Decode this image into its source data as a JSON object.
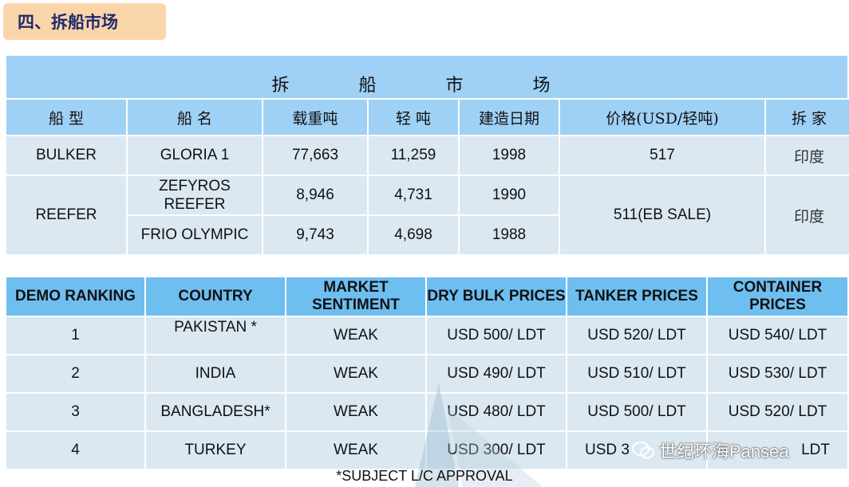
{
  "section_title": "四、拆船市场",
  "table1": {
    "title": "拆 船 市 场",
    "headers": [
      "船  型",
      "船  名",
      "载重吨",
      "轻  吨",
      "建造日期",
      "价格(USD/轻吨)",
      "拆  家"
    ],
    "rows": [
      {
        "type": "BULKER",
        "name": "GLORIA 1",
        "dwt": "77,663",
        "ldt": "11,259",
        "built": "1998",
        "price": "517",
        "buyer": "印度"
      },
      {
        "type": "REEFER",
        "name": "ZEFYROS REEFER",
        "dwt": "8,946",
        "ldt": "4,731",
        "built": "1990",
        "price": "511(EB SALE)",
        "buyer": "印度"
      },
      {
        "name": "FRIO OLYMPIC",
        "dwt": "9,743",
        "ldt": "4,698",
        "built": "1988"
      }
    ]
  },
  "table2": {
    "headers": [
      "DEMO RANKING",
      "COUNTRY",
      "MARKET SENTIMENT",
      "DRY BULK PRICES",
      "TANKER PRICES",
      "CONTAINER PRICES"
    ],
    "rows": [
      {
        "rank": "1",
        "country": "PAKISTAN *",
        "sentiment": "WEAK",
        "dry": "USD 500/ LDT",
        "tanker": "USD 520/ LDT",
        "container": "USD 540/ LDT"
      },
      {
        "rank": "2",
        "country": "INDIA",
        "sentiment": "WEAK",
        "dry": "USD 490/ LDT",
        "tanker": "USD 510/ LDT",
        "container": "USD 530/ LDT"
      },
      {
        "rank": "3",
        "country": "BANGLADESH*",
        "sentiment": "WEAK",
        "dry": "USD 480/ LDT",
        "tanker": "USD 500/ LDT",
        "container": "USD 520/ LDT"
      },
      {
        "rank": "4",
        "country": "TURKEY",
        "sentiment": "WEAK",
        "dry": "USD 300/ LDT",
        "tanker": "USD 3",
        "container": "LDT"
      }
    ]
  },
  "footnote": "*SUBJECT L/C APPROVAL",
  "watermark": "世纪环海Pansea",
  "icons": {
    "wechat": "wechat-icon"
  }
}
